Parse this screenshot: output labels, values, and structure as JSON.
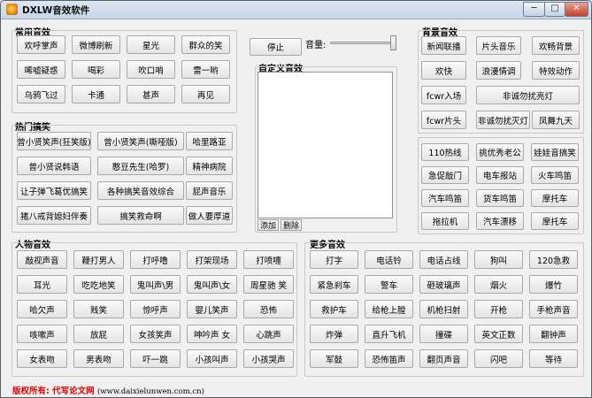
{
  "window": {
    "title": "DXLW音效软件",
    "min": "─",
    "max": "□",
    "close": "✕"
  },
  "common": {
    "title": "常用音效",
    "items": [
      "欢呼掌声",
      "微博刷新",
      "星光",
      "群众的笑",
      "唏嘘疑惑",
      "喝彩",
      "吹口哨",
      "雷一哟",
      "乌鸦飞过",
      "卡通",
      "甚声",
      "再见"
    ]
  },
  "hot": {
    "title": "热门搞笑",
    "items": [
      "曾小贤笑声(狂笑版)",
      "曾小贤笑声(嘶哑版)",
      "哈里路亚",
      "曾小贤说韩语",
      "憨豆先生(哈罗)",
      "精神病院",
      "让子弹飞葛优搞笑",
      "各种搞笑音效综合",
      "屁声音乐",
      "猪八戒背媳妇伴奏",
      "搞笑救命啊",
      "做人要厚道"
    ]
  },
  "center": {
    "stop": "停止",
    "volume_label": "音量:",
    "custom_title": "自定义音效",
    "add": "添加",
    "delete": "删除"
  },
  "background": {
    "title": "背景音效",
    "items": [
      "新闻联播",
      "片头音乐",
      "欢畅背景",
      "欢快",
      "浪漫情调",
      "特效动作",
      "fcwr入场",
      "非诚勿扰亮灯",
      "fcwr片头",
      "非诚勿扰灭灯",
      "凤舞九天"
    ]
  },
  "right_extra": {
    "items": [
      "110热线",
      "挑优秀老公",
      "娃娃音搞笑",
      "急促敲门",
      "电车报站",
      "火车鸣笛",
      "汽车鸣笛",
      "货车鸣笛",
      "摩托车",
      "拖拉机",
      "汽车漂移",
      "摩托车"
    ]
  },
  "people": {
    "title": "人物音效",
    "items": [
      "敲视声音",
      "鞭打男人",
      "打呼噜",
      "打架现场",
      "打喷嚏",
      "耳光",
      "吃吃地笑",
      "鬼叫声\\男",
      "鬼叫声\\女",
      "周星驰 笑",
      "哈欠声",
      "贱笑",
      "惊呼声",
      "婴儿笑声",
      "恐怖",
      "咳嗽声",
      "放屁",
      "女孩笑声",
      "呻吟声 女",
      "心跳声",
      "女表吻",
      "男表吻",
      "吓一跳",
      "小孩叫声",
      "小孩哭声"
    ]
  },
  "more": {
    "title": "更多音效",
    "items": [
      "打字",
      "电话铃",
      "电话占线",
      "狗叫",
      "120急救",
      "紧急刹车",
      "警车",
      "砸玻璃声",
      "烟火",
      "爆竹",
      "救护车",
      "给枪上膛",
      "机枪扫射",
      "开枪",
      "手枪声音",
      "炸弹",
      "直升飞机",
      "撞碟",
      "英文正数",
      "翻钟声",
      "军鼓",
      "恐怖笛声",
      "翻页声音",
      "闪吧",
      "等待"
    ]
  },
  "footer": {
    "label": "版权所有:",
    "company": "代写论文网",
    "url": "(www.daixielunwen.com.cn)"
  }
}
